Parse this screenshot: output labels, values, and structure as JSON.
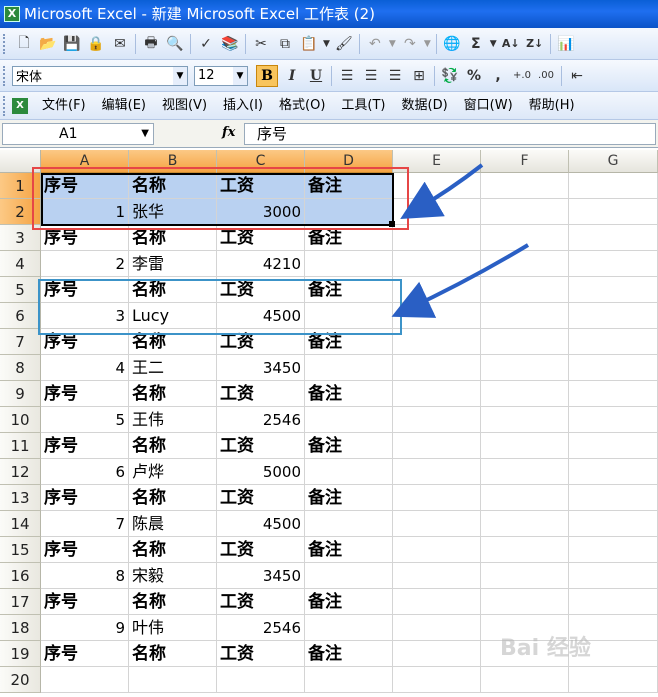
{
  "window": {
    "title": "Microsoft Excel - 新建 Microsoft Excel 工作表 (2)"
  },
  "formatting": {
    "font_name": "宋体",
    "font_size": "12",
    "bold": "B",
    "italic": "I",
    "underline": "U",
    "percent": "%",
    "comma": ","
  },
  "menu": [
    "文件(F)",
    "编辑(E)",
    "视图(V)",
    "插入(I)",
    "格式(O)",
    "工具(T)",
    "数据(D)",
    "窗口(W)",
    "帮助(H)"
  ],
  "formula_bar": {
    "name_box": "A1",
    "fx": "fx",
    "content": "序号"
  },
  "columns": [
    "A",
    "B",
    "C",
    "D",
    "E",
    "F",
    "G"
  ],
  "rows": [
    [
      "序号",
      "名称",
      "工资",
      "备注"
    ],
    [
      "1",
      "张华",
      "3000",
      ""
    ],
    [
      "序号",
      "名称",
      "工资",
      "备注"
    ],
    [
      "2",
      "李雷",
      "4210",
      ""
    ],
    [
      "序号",
      "名称",
      "工资",
      "备注"
    ],
    [
      "3",
      "Lucy",
      "4500",
      ""
    ],
    [
      "序号",
      "名称",
      "工资",
      "备注"
    ],
    [
      "4",
      "王二",
      "3450",
      ""
    ],
    [
      "序号",
      "名称",
      "工资",
      "备注"
    ],
    [
      "5",
      "王伟",
      "2546",
      ""
    ],
    [
      "序号",
      "名称",
      "工资",
      "备注"
    ],
    [
      "6",
      "卢烨",
      "5000",
      ""
    ],
    [
      "序号",
      "名称",
      "工资",
      "备注"
    ],
    [
      "7",
      "陈晨",
      "4500",
      ""
    ],
    [
      "序号",
      "名称",
      "工资",
      "备注"
    ],
    [
      "8",
      "宋毅",
      "3450",
      ""
    ],
    [
      "序号",
      "名称",
      "工资",
      "备注"
    ],
    [
      "9",
      "叶伟",
      "2546",
      ""
    ],
    [
      "序号",
      "名称",
      "工资",
      "备注"
    ],
    [
      "",
      "",
      "",
      ""
    ]
  ],
  "row_numbers": [
    "1",
    "2",
    "3",
    "4",
    "5",
    "6",
    "7",
    "8",
    "9",
    "10",
    "11",
    "12",
    "13",
    "14",
    "15",
    "16",
    "17",
    "18",
    "19",
    "20"
  ],
  "selection": {
    "range": "A1:D2"
  },
  "annotation_colors": {
    "red_box": "#e64646",
    "blue_box": "#3c93c8",
    "arrow": "#2a5fc4"
  },
  "watermark": "Bai 经验"
}
